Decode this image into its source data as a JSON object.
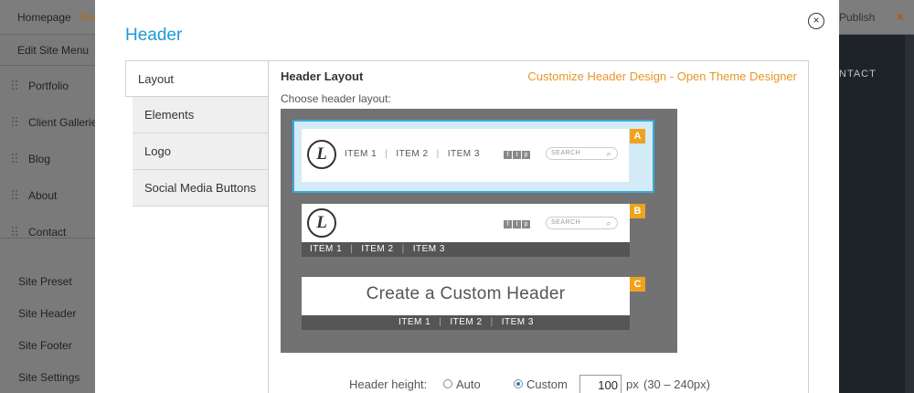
{
  "background": {
    "topbar": {
      "homepage": "Homepage",
      "preview_partial": "Pre",
      "publish": "Publish",
      "close_symbol": "×"
    },
    "sidebar": {
      "edit_menu": "Edit Site Menu",
      "nav_items": [
        "Portfolio",
        "Client Galleries",
        "Blog",
        "About",
        "Contact"
      ],
      "settings_items": [
        "Site Preset",
        "Site Header",
        "Site Footer",
        "Site Settings"
      ]
    },
    "right_panel": {
      "nav_text": "NTACT"
    }
  },
  "modal": {
    "title": "Header",
    "close_symbol": "×",
    "tabs": [
      {
        "label": "Layout",
        "active": true
      },
      {
        "label": "Elements",
        "active": false
      },
      {
        "label": "Logo",
        "active": false
      },
      {
        "label": "Social Media Buttons",
        "active": false
      }
    ],
    "panel": {
      "title": "Header Layout",
      "designer_link": "Customize Header Design - Open Theme Designer",
      "choose_label": "Choose header layout:",
      "options": [
        {
          "badge": "A",
          "selected": true,
          "logo_letter": "L",
          "items": [
            "ITEM 1",
            "ITEM 2",
            "ITEM 3"
          ],
          "search": "SEARCH",
          "search_icon": "⌕"
        },
        {
          "badge": "B",
          "selected": false,
          "logo_letter": "L",
          "items": [
            "ITEM 1",
            "ITEM 2",
            "ITEM 3"
          ],
          "search": "SEARCH",
          "search_icon": "⌕"
        },
        {
          "badge": "C",
          "selected": false,
          "title": "Create a Custom Header",
          "items": [
            "ITEM 1",
            "ITEM 2",
            "ITEM 3"
          ]
        }
      ],
      "separator": "|",
      "social_glyphs": [
        "f",
        "t",
        "p"
      ],
      "header_height": {
        "label": "Header height:",
        "auto_label": "Auto",
        "custom_label": "Custom",
        "selected": "Custom",
        "value": "100",
        "unit": "px",
        "range": "(30 – 240px)"
      }
    }
  },
  "colors": {
    "accent_blue": "#1e9ad6",
    "link_orange": "#e8962a",
    "badge_orange": "#f0a21e"
  }
}
